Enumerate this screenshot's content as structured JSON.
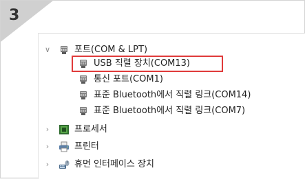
{
  "step": {
    "number": "3"
  },
  "tree": {
    "ports_category": {
      "label": "포트(COM & LPT)",
      "expanded": true,
      "icon": "port-connector-icon"
    },
    "port_items": [
      {
        "label": "USB 직렬 장치(COM13)",
        "icon": "port-connector-icon",
        "highlighted": true
      },
      {
        "label": "통신 포트(COM1)",
        "icon": "port-connector-icon"
      },
      {
        "label": "표준 Bluetooth에서 직렬 링크(COM14)",
        "icon": "port-connector-icon"
      },
      {
        "label": "표준 Bluetooth에서 직렬 링크(COM7)",
        "icon": "port-connector-icon"
      }
    ],
    "collapsed_categories": [
      {
        "label": "프로세서",
        "icon": "processor-chip-icon",
        "expanded": false
      },
      {
        "label": "프린터",
        "icon": "printer-icon",
        "expanded": false
      },
      {
        "label": "휴먼 인터페이스 장치",
        "icon": "hid-device-icon",
        "expanded": false
      }
    ]
  },
  "colors": {
    "highlight": "#e03a3a",
    "corner": "#d0d0d0"
  }
}
